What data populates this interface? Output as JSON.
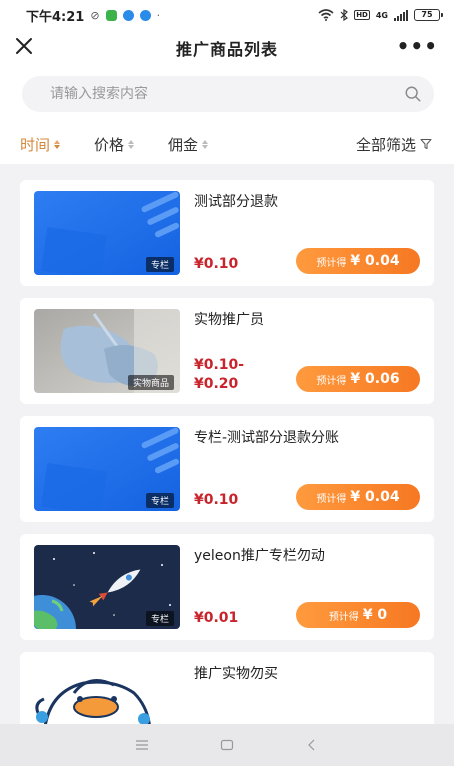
{
  "status_bar": {
    "time": "下午4:21",
    "network": "4G",
    "battery": "75"
  },
  "nav": {
    "title": "推广商品列表",
    "more": "•••"
  },
  "search": {
    "placeholder": "请输入搜索内容"
  },
  "filters": {
    "time": "时间",
    "price": "价格",
    "commission": "佣金",
    "all": "全部筛选"
  },
  "products": [
    {
      "title": "测试部分退款",
      "tag": "专栏",
      "price": "¥0.10",
      "earn_label": "预计得",
      "earn_amount": "¥ 0.04"
    },
    {
      "title": "实物推广员",
      "tag": "实物商品",
      "price_line1": "¥0.10-",
      "price_line2": "¥0.20",
      "earn_label": "预计得",
      "earn_amount": "¥ 0.06"
    },
    {
      "title": "专栏-测试部分退款分账",
      "tag": "专栏",
      "price": "¥0.10",
      "earn_label": "预计得",
      "earn_amount": "¥ 0.04"
    },
    {
      "title": "yeleon推广专栏勿动",
      "tag": "专栏",
      "price": "¥0.01",
      "earn_label": "预计得",
      "earn_amount": "¥ 0"
    },
    {
      "title": "推广实物勿买"
    }
  ],
  "colors": {
    "accent": "#d4883a",
    "price": "#c8242c",
    "button_start": "#ff9a3e",
    "button_end": "#f67822"
  }
}
